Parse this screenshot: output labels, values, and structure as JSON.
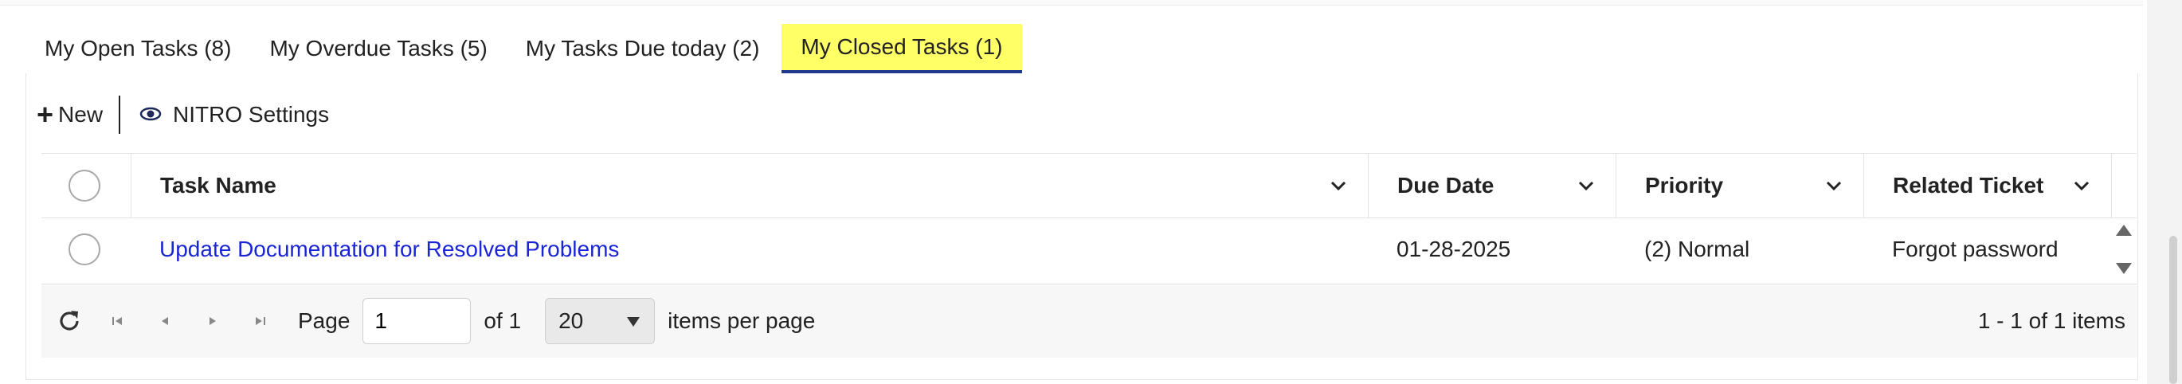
{
  "tabs": [
    {
      "label": "My Open Tasks (8)"
    },
    {
      "label": "My Overdue Tasks (5)"
    },
    {
      "label": "My Tasks Due today (2)"
    },
    {
      "label": "My Closed Tasks (1)",
      "active": true
    }
  ],
  "colors": {
    "active_tab_bg": "#ffff66",
    "active_tab_underline": "#1f3a8a",
    "link": "#1a25d6"
  },
  "toolbar": {
    "new_label": "New",
    "new_icon": "plus-icon",
    "settings_label": "NITRO Settings",
    "settings_icon": "eye-icon"
  },
  "grid": {
    "columns": [
      "Task Name",
      "Due Date",
      "Priority",
      "Related Ticket"
    ],
    "rows": [
      {
        "task_name": "Update Documentation for Resolved Problems",
        "due_date": "01-28-2025",
        "priority": "(2) Normal",
        "related_ticket": "Forgot password"
      }
    ]
  },
  "pager": {
    "page_label": "Page",
    "page_value": "1",
    "of_label": "of 1",
    "page_size": "20",
    "items_per_page_label": "items per page",
    "summary": "1 - 1 of 1 items"
  }
}
